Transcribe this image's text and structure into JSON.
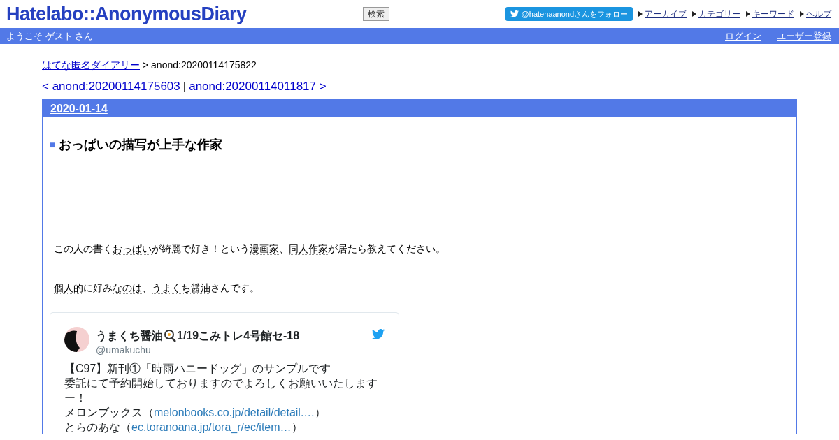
{
  "header": {
    "logo": "Hatelabo::AnonymousDiary",
    "search_button": "検索",
    "follow_button": "@hatenaanondさんをフォロー",
    "nav_links": [
      "アーカイブ",
      "カテゴリー",
      "キーワード",
      "ヘルプ"
    ]
  },
  "user_bar": {
    "greeting": "ようこそ ゲスト さん",
    "links": [
      "ログイン",
      "ユーザー登録"
    ]
  },
  "breadcrumb": {
    "link": "はてな匿名ダイアリー",
    "current": "> anond:20200114175822"
  },
  "pager": {
    "prev": "< anond:20200114175603",
    "separator": "|",
    "next": "anond:20200114011817 >"
  },
  "day": {
    "date": "2020-01-14",
    "title": {
      "mark": "■",
      "segments": [
        {
          "kind": "keyword",
          "text": "おっぱい"
        },
        {
          "kind": "text",
          "text": "の"
        },
        {
          "kind": "keyword",
          "text": "描写"
        },
        {
          "kind": "text",
          "text": "が"
        },
        {
          "kind": "keyword",
          "text": "上手"
        },
        {
          "kind": "text",
          "text": "な"
        },
        {
          "kind": "keyword",
          "text": "作家"
        }
      ]
    },
    "paragraphs": [
      [
        {
          "kind": "text",
          "text": "この人の書く"
        },
        {
          "kind": "keyword",
          "text": "おっぱい"
        },
        {
          "kind": "text",
          "text": "が綺麗で好き！という"
        },
        {
          "kind": "keyword",
          "text": "漫画家"
        },
        {
          "kind": "text",
          "text": "、"
        },
        {
          "kind": "keyword",
          "text": "同人作家"
        },
        {
          "kind": "text",
          "text": "が居たら教えてください。"
        }
      ],
      [
        {
          "kind": "keyword",
          "text": "個人的"
        },
        {
          "kind": "text",
          "text": "に好み"
        },
        {
          "kind": "keyword",
          "text": "なのは"
        },
        {
          "kind": "text",
          "text": "、"
        },
        {
          "kind": "keyword",
          "text": "うまくち醤油"
        },
        {
          "kind": "text",
          "text": "さんです。"
        }
      ]
    ],
    "tweet": {
      "name_parts": [
        "うまくち醤油",
        "1/19こみトレ4号館セ-18"
      ],
      "handle": "@umakuchu",
      "lines": [
        [
          {
            "kind": "text",
            "text": "【C97】新刊①「時雨ハニードッグ」のサンプルです"
          }
        ],
        [
          {
            "kind": "text",
            "text": "委託にて予約開始しておりますのでよろしくお願いいたします"
          }
        ],
        [
          {
            "kind": "text",
            "text": "ー！"
          }
        ],
        [
          {
            "kind": "text",
            "text": "メロンブックス（"
          },
          {
            "kind": "link",
            "text": "melonbooks.co.jp/detail/detail.…"
          },
          {
            "kind": "text",
            "text": "）"
          }
        ],
        [
          {
            "kind": "text",
            "text": "とらのあな（"
          },
          {
            "kind": "link",
            "text": "ec.toranoana.jp/tora_r/ec/item…"
          },
          {
            "kind": "text",
            "text": "）"
          }
        ]
      ]
    }
  }
}
